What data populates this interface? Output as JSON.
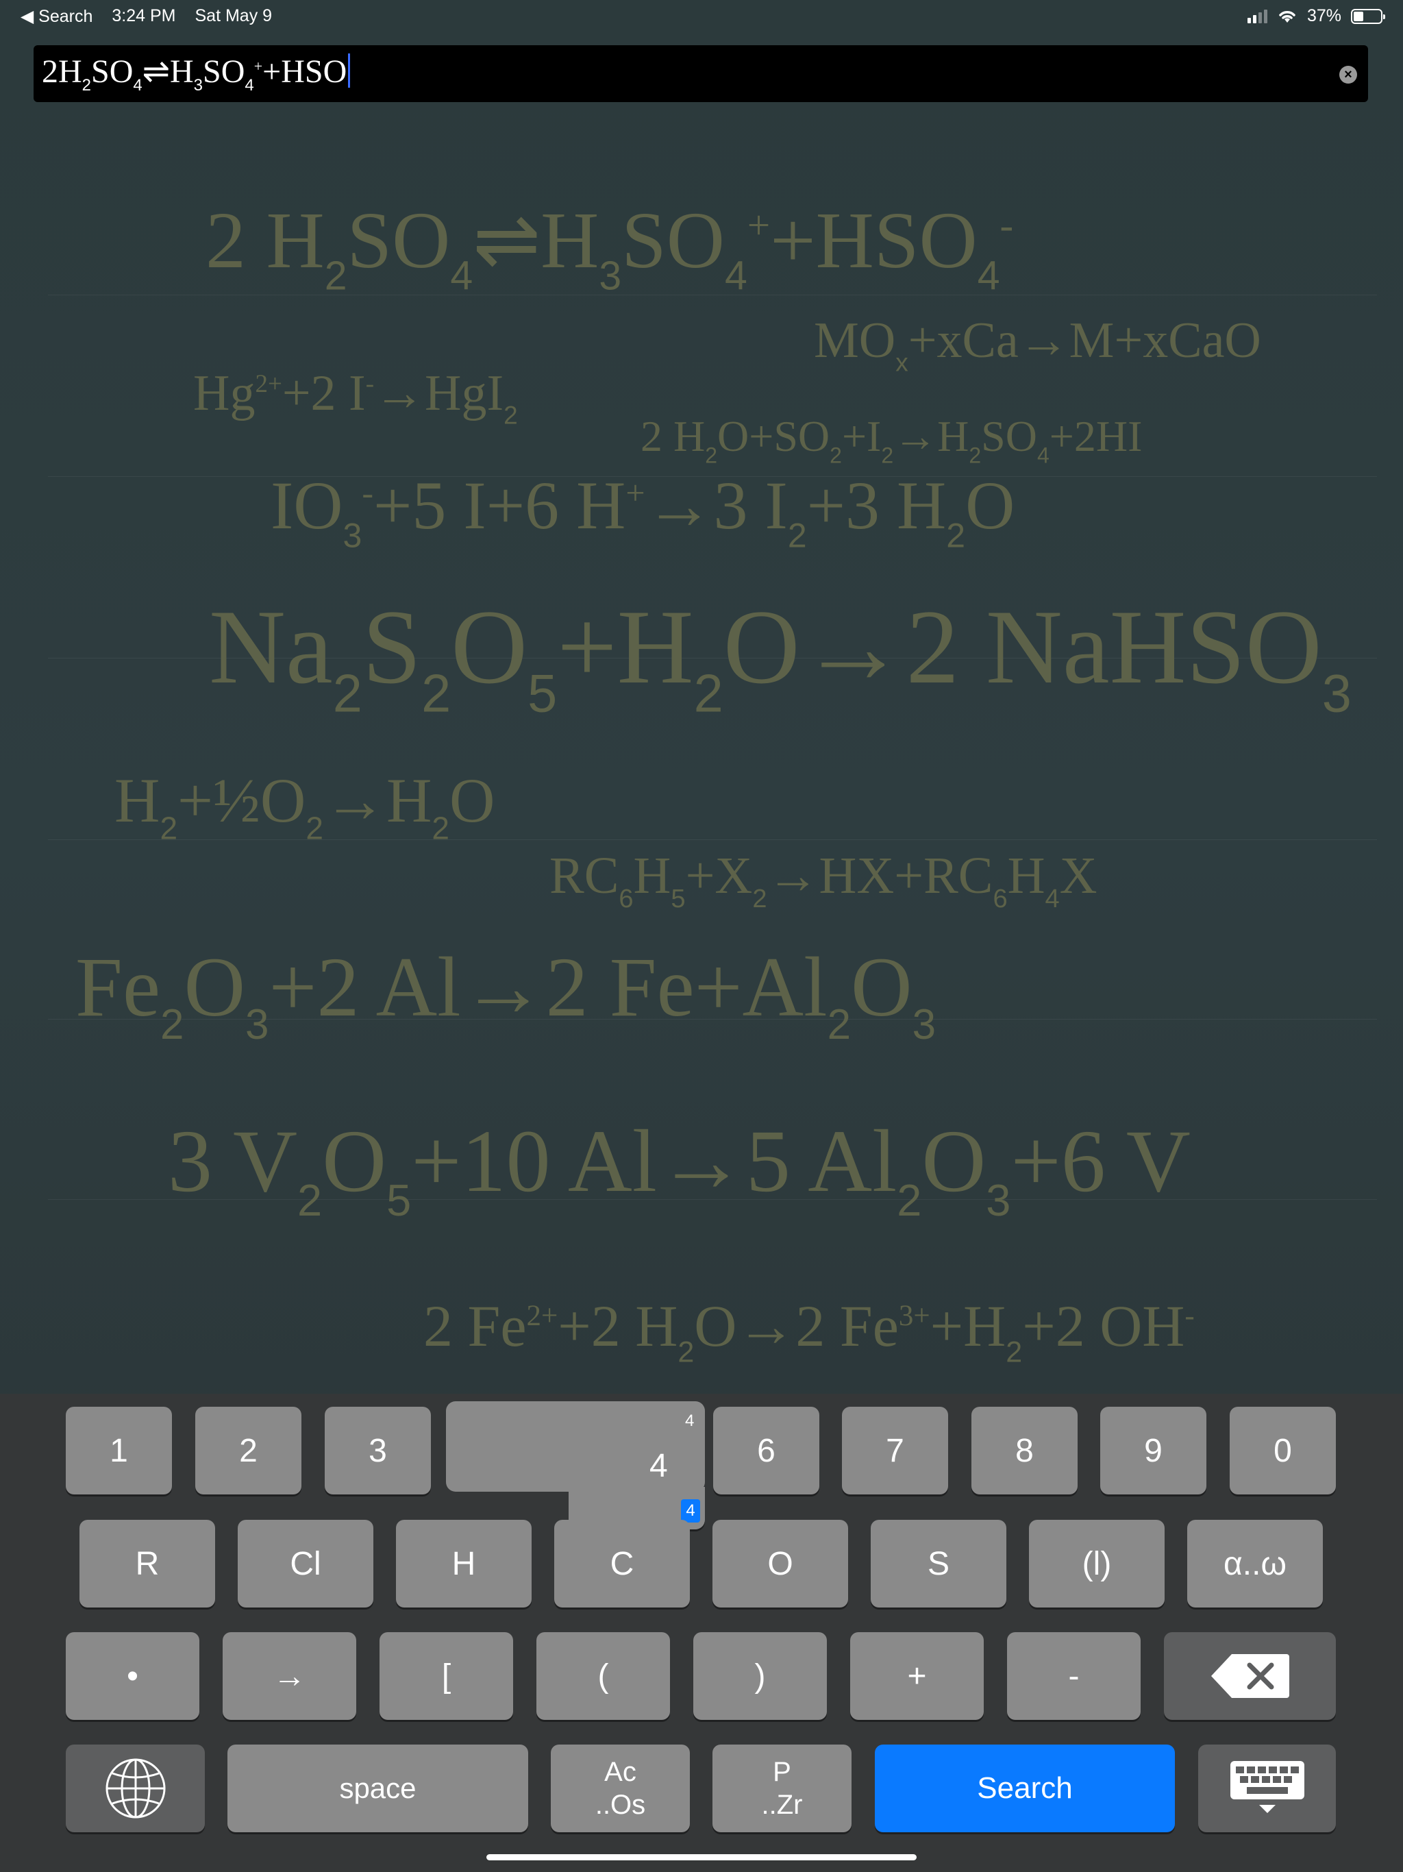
{
  "status_bar": {
    "back_label": "◀ Search",
    "time": "3:24 PM",
    "date": "Sat May 9",
    "battery_text": "37%",
    "battery_level": 0.37
  },
  "search": {
    "value_parts": [
      "2H",
      "2",
      "SO",
      "4",
      "⇌H",
      "3",
      "SO",
      "4",
      "+",
      "+HSO"
    ]
  },
  "equations": [
    {
      "id": "e1",
      "parts": [
        "2 H",
        "2",
        "SO",
        "4",
        "⇌H",
        "3",
        "SO",
        "4",
        "+",
        "+HSO",
        "4",
        "-"
      ]
    },
    {
      "id": "e2",
      "parts": [
        "MO",
        "x",
        "+xCa→M+xCaO"
      ]
    },
    {
      "id": "e3",
      "parts": [
        "Hg",
        "2+",
        "+2 I",
        "-",
        "→HgI",
        "2"
      ]
    },
    {
      "id": "e4",
      "parts": [
        "2 H",
        "2",
        "O+SO",
        "2",
        "+I",
        "2",
        "→H",
        "2",
        "SO",
        "4",
        "+2HI"
      ]
    },
    {
      "id": "e5",
      "parts": [
        "IO",
        "3",
        "-",
        "+5 I+6 H",
        "+",
        "→3 I",
        "2",
        "+3 H",
        "2",
        "O"
      ]
    },
    {
      "id": "e6",
      "parts": [
        "Na",
        "2",
        "S",
        "2",
        "O",
        "5",
        "+H",
        "2",
        "O→2 NaHSO",
        "3"
      ]
    },
    {
      "id": "e7",
      "parts": [
        "H",
        "2",
        "+½O",
        "2",
        "→H",
        "2",
        "O"
      ]
    },
    {
      "id": "e8",
      "parts": [
        "RC",
        "6",
        "H",
        "5",
        "+X",
        "2",
        "→HX+RC",
        "6",
        "H",
        "4",
        "X"
      ]
    },
    {
      "id": "e9",
      "parts": [
        "Fe",
        "2",
        "O",
        "3",
        "+2 Al→2 Fe+Al",
        "2",
        "O",
        "3"
      ]
    },
    {
      "id": "e10",
      "parts": [
        "3 V",
        "2",
        "O",
        "5",
        "+10 Al→5 Al",
        "2",
        "O",
        "3",
        "+6 V"
      ]
    },
    {
      "id": "e11",
      "parts": [
        "2 Fe",
        "2+",
        "+2 H",
        "2",
        "O→2 Fe",
        "3+",
        "+H",
        "2",
        "+2 OH",
        "-"
      ]
    }
  ],
  "keyboard": {
    "row1": [
      "1",
      "2",
      "3",
      "6",
      "7",
      "8",
      "9",
      "0"
    ],
    "popup": {
      "main": "4",
      "top": "4",
      "badge": "4"
    },
    "row2": [
      "R",
      "Cl",
      "H",
      "C",
      "O",
      "S",
      "(l)",
      "α..ω"
    ],
    "row3": [
      "•",
      "→",
      "[",
      "(",
      ")",
      "+",
      "-"
    ],
    "space": "space",
    "ac_top": "Ac",
    "ac_bottom": "..Os",
    "p_top": "P",
    "p_bottom": "..Zr",
    "search": "Search"
  },
  "colors": {
    "equation_text": "#5d6249",
    "key_face": "#8a8a8a",
    "accent": "#0a7aff"
  }
}
